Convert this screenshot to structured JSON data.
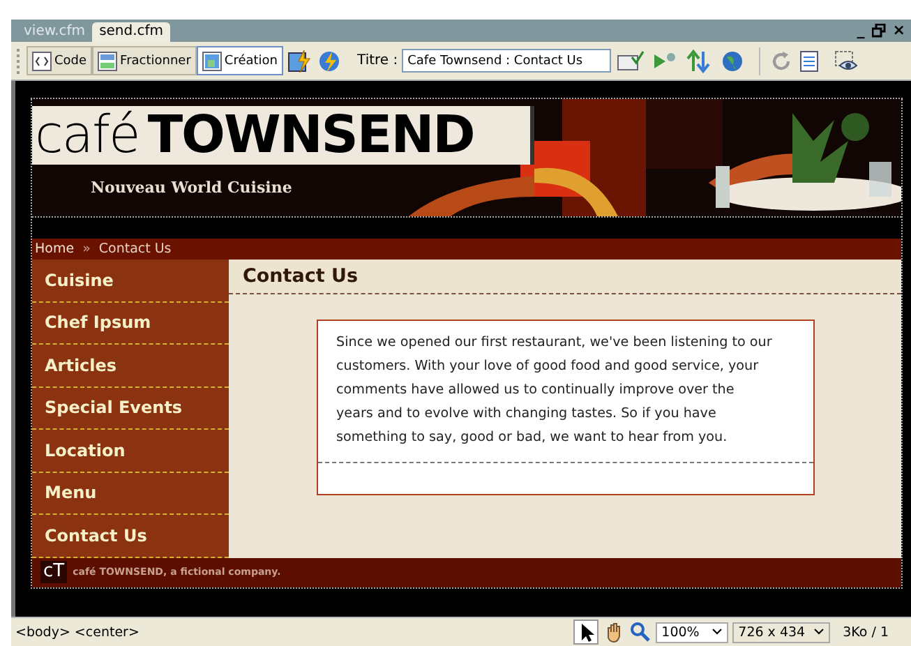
{
  "tabs": [
    {
      "label": "view.cfm",
      "selected": false
    },
    {
      "label": "send.cfm",
      "selected": true
    }
  ],
  "window_controls": {
    "minimize": "_",
    "close": "×"
  },
  "toolbar": {
    "view_buttons": [
      {
        "label": "Code",
        "kind": "code",
        "selected": false
      },
      {
        "label": "Fractionner",
        "kind": "split",
        "selected": false
      },
      {
        "label": "Création",
        "kind": "design",
        "selected": true
      }
    ],
    "title_label": "Titre :",
    "title_value": "Cafe Townsend : Contact Us"
  },
  "page": {
    "logo_light": "café",
    "logo_bold": "TOWNSEND",
    "tagline": "Nouveau World Cuisine",
    "breadcrumb": {
      "home": "Home",
      "separator": "»",
      "current": "Contact Us"
    },
    "nav": [
      {
        "label": "Cuisine"
      },
      {
        "label": "Chef Ipsum"
      },
      {
        "label": "Articles"
      },
      {
        "label": "Special Events"
      },
      {
        "label": "Location"
      },
      {
        "label": "Menu"
      },
      {
        "label": "Contact Us"
      }
    ],
    "heading": "Contact Us",
    "message": "Since we opened our first restaurant, we've been listening to our customers. With your love of good food and good service, your comments have allowed us to continually improve over the years and to evolve with changing tastes. So if you have something to say, good or bad, we want to hear from you.",
    "footer_mark": "cT",
    "footer_text": "café TOWNSEND, a fictional company."
  },
  "status_bar": {
    "tag_path": "<body> <center>",
    "zoom": "100%",
    "dimensions": "726 x 434",
    "size": "3Ko / 1"
  }
}
